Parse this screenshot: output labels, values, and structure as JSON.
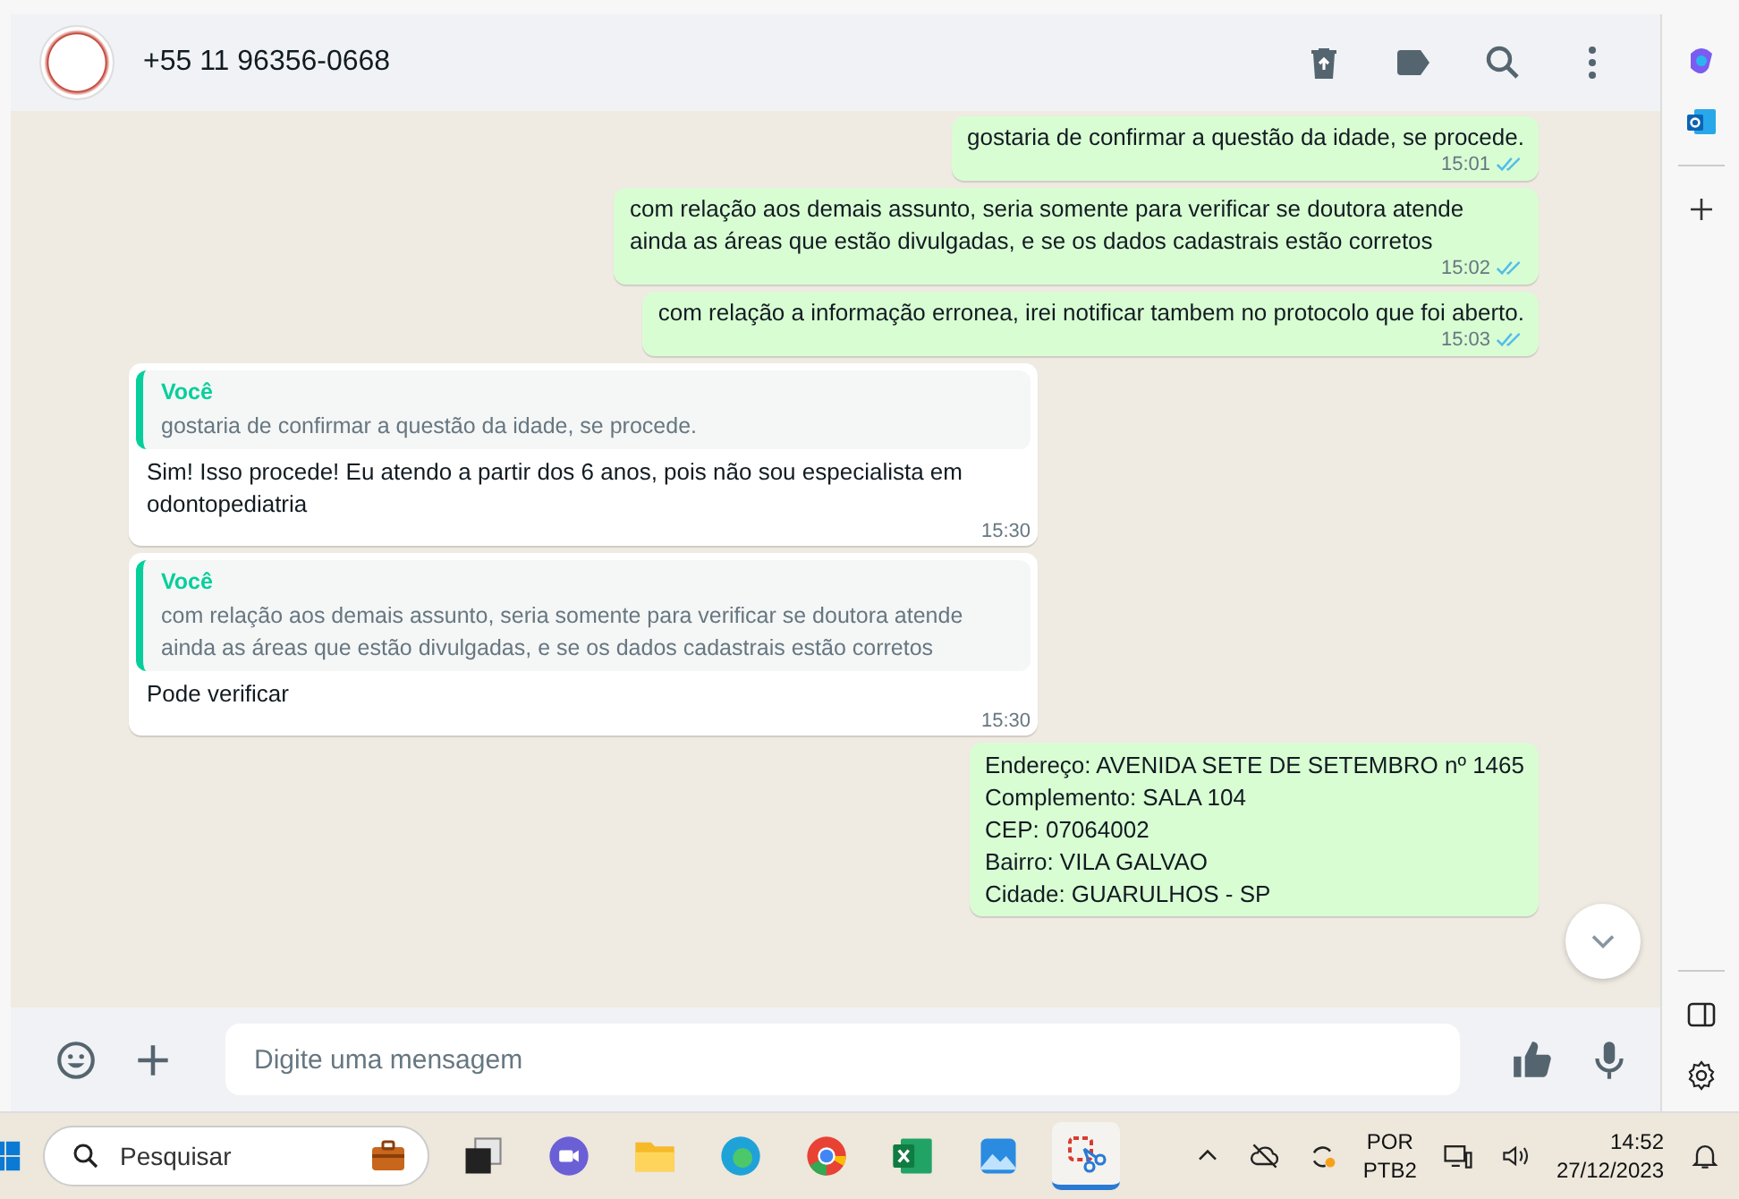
{
  "header": {
    "contact_name": "+55 11 96356-0668"
  },
  "messages": [
    {
      "kind": "outgoing",
      "text": "gostaria de confirmar a questão da idade, se procede.",
      "time": "15:01",
      "read": true
    },
    {
      "kind": "outgoing",
      "text": "com relação aos demais assunto, seria somente para verificar se doutora atende ainda as áreas que estão divulgadas, e se os dados cadastrais estão corretos",
      "time": "15:02",
      "read": true
    },
    {
      "kind": "outgoing",
      "text": "com relação a informação erronea, irei notificar tambem no protocolo que foi aberto.",
      "time": "15:03",
      "read": true
    },
    {
      "kind": "incoming",
      "quote": {
        "author": "Você",
        "text": "gostaria de confirmar a questão da idade, se procede."
      },
      "text": "Sim! Isso procede! Eu atendo a partir dos 6 anos, pois não sou especialista em odontopediatria",
      "time": "15:30"
    },
    {
      "kind": "incoming",
      "quote": {
        "author": "Você",
        "text": "com relação aos demais assunto, seria somente para verificar se doutora atende ainda as áreas que estão divulgadas, e se os dados cadastrais estão corretos"
      },
      "text": "Pode verificar",
      "time": "15:30"
    },
    {
      "kind": "address",
      "lines": [
        "Endereço: AVENIDA SETE DE SETEMBRO nº 1465",
        "Complemento: SALA 104",
        "CEP: 07064002",
        "Bairro: VILA GALVAO",
        "Cidade: GUARULHOS - SP"
      ]
    }
  ],
  "composer": {
    "placeholder": "Digite uma mensagem"
  },
  "taskbar": {
    "search_placeholder": "Pesquisar",
    "language": "POR",
    "layout": "PTB2",
    "time": "14:52",
    "date": "27/12/2023"
  }
}
